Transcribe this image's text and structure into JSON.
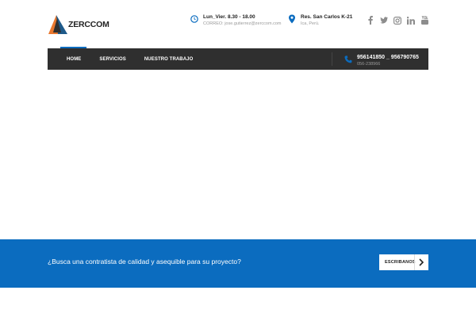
{
  "brand": {
    "name": "ZERCCOM"
  },
  "header": {
    "hours": {
      "title": "Lun_Vier. 8.30 - 18.00",
      "sub": "CORREO: jose.gutierrez@zerccom.com",
      "icon": "clock-icon"
    },
    "address": {
      "title": "Res. San Carlos K-21",
      "sub": "Ica, Perú.",
      "icon": "map-pin-icon"
    },
    "socials": [
      "facebook-icon",
      "twitter-icon",
      "instagram-icon",
      "linkedin-icon",
      "youtube-icon"
    ]
  },
  "nav": {
    "items": [
      "HOME",
      "SERVICIOS",
      "NUESTRO TRABAJO"
    ],
    "active": "HOME",
    "phone": {
      "main": "956141850 _ 956790765",
      "sub": "056-238966",
      "icon": "phone-icon"
    }
  },
  "cta": {
    "text": "¿Busca una contratista de calidad y asequible para su proyecto?",
    "button_label": "ESCRIBANOS",
    "button_icon": "chevron-right-icon"
  },
  "colors": {
    "accent": "#0b6cbf",
    "nav_bg": "#2f2f2f",
    "logo_orange": "#e8772e",
    "logo_blue": "#1e5a8a"
  }
}
